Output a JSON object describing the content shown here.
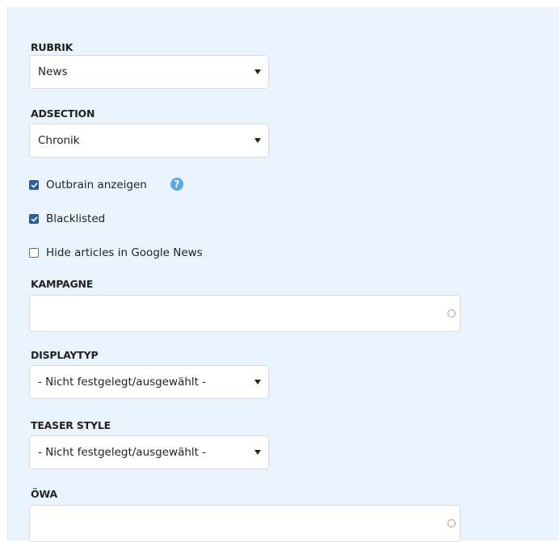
{
  "form": {
    "rubrik": {
      "label": "RUBRIK",
      "value": "News"
    },
    "adsection": {
      "label": "ADSECTION",
      "value": "Chronik"
    },
    "checkboxes": [
      {
        "label": "Outbrain anzeigen",
        "checked": true,
        "help": "?"
      },
      {
        "label": "Blacklisted",
        "checked": true
      },
      {
        "label": "Hide articles in Google News",
        "checked": false
      }
    ],
    "kampagne": {
      "label": "KAMPAGNE",
      "value": ""
    },
    "displaytyp": {
      "label": "DISPLAYTYP",
      "value": "- Nicht festgelegt/ausgewählt -"
    },
    "teaser_style": {
      "label": "TEASER STYLE",
      "value": "- Nicht festgelegt/ausgewählt -"
    },
    "oewa": {
      "label": "ÖWA",
      "value": ""
    }
  },
  "colors": {
    "panel_background": "#eaf4fd",
    "checkbox_checked": "#2f5f9a",
    "help_icon": "#5aa9e6"
  }
}
